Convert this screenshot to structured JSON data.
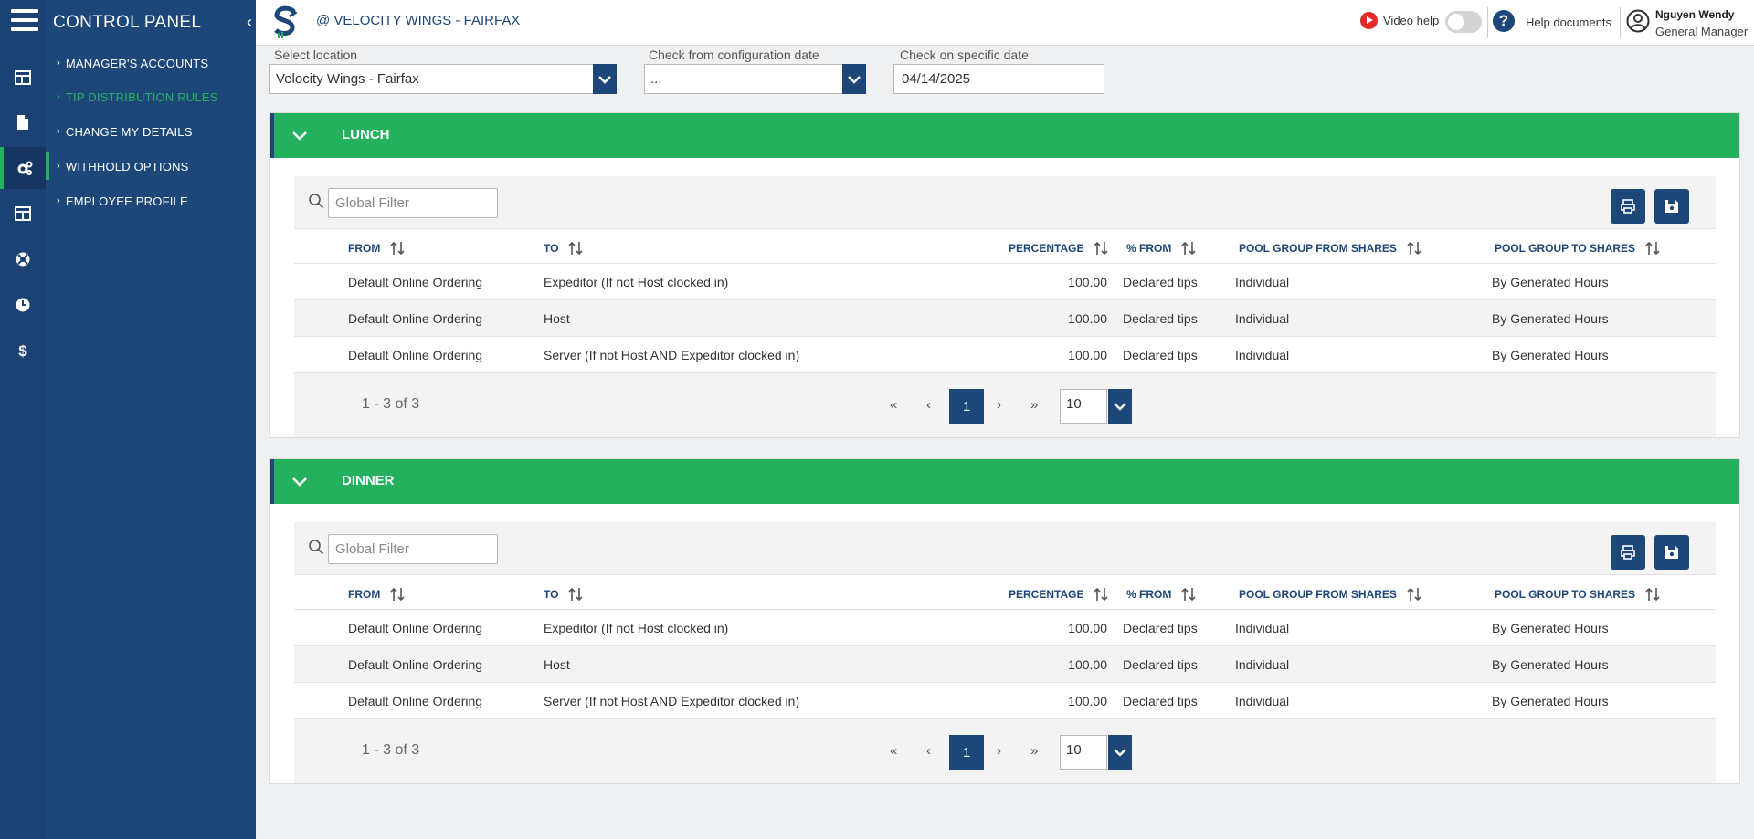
{
  "sidebar": {
    "title": "CONTROL PANEL",
    "items": [
      {
        "label": "MANAGER'S ACCOUNTS"
      },
      {
        "label": "TIP DISTRIBUTION RULES"
      },
      {
        "label": "CHANGE MY DETAILS"
      },
      {
        "label": "WITHHOLD OPTIONS"
      },
      {
        "label": "EMPLOYEE PROFILE"
      }
    ],
    "rail_icons": [
      "layout-icon",
      "document-icon",
      "gears-icon",
      "table-icon",
      "lifebuoy-icon",
      "clock-icon",
      "dollar-icon"
    ]
  },
  "header": {
    "location_title": "@ VELOCITY WINGS - FAIRFAX",
    "video_help": "Video help",
    "help_documents": "Help documents",
    "user_name": "Nguyen Wendy",
    "user_role": "General Manager"
  },
  "filters": {
    "location_label": "Select location",
    "location_value": "Velocity Wings - Fairfax",
    "config_label": "Check from configuration date",
    "config_value": "...",
    "date_label": "Check on specific date",
    "date_value": "04/14/2025"
  },
  "columns": {
    "from": "FROM",
    "to": "TO",
    "percentage": "PERCENTAGE",
    "pct_from": "% FROM",
    "pool_from": "POOL GROUP FROM SHARES",
    "pool_to": "POOL GROUP TO SHARES"
  },
  "global_filter_placeholder": "Global Filter",
  "sections": [
    {
      "title": "LUNCH",
      "rows": [
        {
          "from": "Default Online Ordering",
          "to": "Expeditor (If not Host clocked in)",
          "percentage": "100.00",
          "pct_from": "Declared tips",
          "pool_from": "Individual",
          "pool_to": "By Generated Hours"
        },
        {
          "from": "Default Online Ordering",
          "to": "Host",
          "percentage": "100.00",
          "pct_from": "Declared tips",
          "pool_from": "Individual",
          "pool_to": "By Generated Hours"
        },
        {
          "from": "Default Online Ordering",
          "to": "Server (If not Host AND Expeditor clocked in)",
          "percentage": "100.00",
          "pct_from": "Declared tips",
          "pool_from": "Individual",
          "pool_to": "By Generated Hours"
        }
      ],
      "pager": {
        "info": "1 - 3 of 3",
        "current": "1",
        "first": "«",
        "prev": "‹",
        "next": "›",
        "last": "»",
        "per_page": "10"
      }
    },
    {
      "title": "DINNER",
      "rows": [
        {
          "from": "Default Online Ordering",
          "to": "Expeditor (If not Host clocked in)",
          "percentage": "100.00",
          "pct_from": "Declared tips",
          "pool_from": "Individual",
          "pool_to": "By Generated Hours"
        },
        {
          "from": "Default Online Ordering",
          "to": "Host",
          "percentage": "100.00",
          "pct_from": "Declared tips",
          "pool_from": "Individual",
          "pool_to": "By Generated Hours"
        },
        {
          "from": "Default Online Ordering",
          "to": "Server (If not Host AND Expeditor clocked in)",
          "percentage": "100.00",
          "pct_from": "Declared tips",
          "pool_from": "Individual",
          "pool_to": "By Generated Hours"
        }
      ],
      "pager": {
        "info": "1 - 3 of 3",
        "current": "1",
        "first": "«",
        "prev": "‹",
        "next": "›",
        "last": "»",
        "per_page": "10"
      }
    }
  ],
  "colors": {
    "navy": "#1d4779",
    "green": "#23b15e",
    "rail": "#1c4273",
    "red": "#e42b2b"
  }
}
